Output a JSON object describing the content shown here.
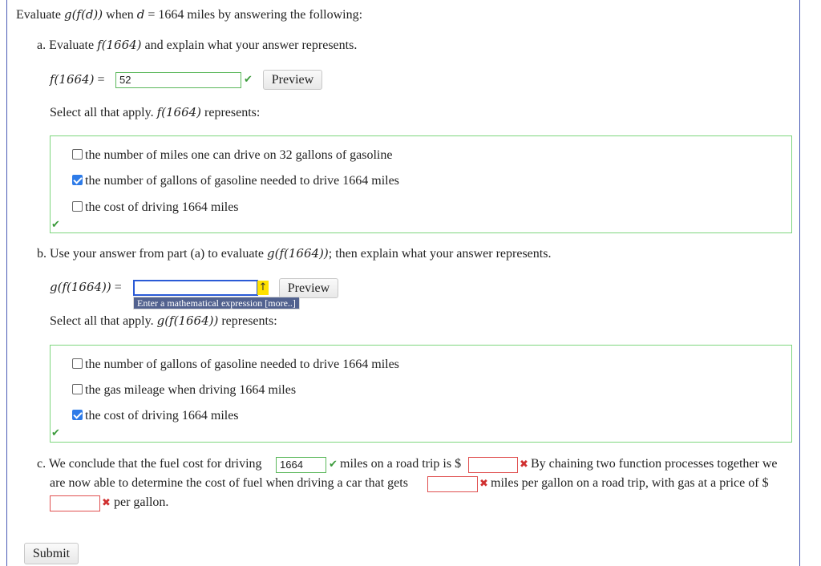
{
  "intro": {
    "pre": "Evaluate ",
    "expr": "g(f(d))",
    "mid": " when ",
    "var": "d",
    "eq": " = 1664 miles by answering the following:"
  },
  "part_a": {
    "heading": "a. Evaluate ",
    "heading_expr": "f(1664)",
    "heading_post": " and explain what your answer represents.",
    "lhs": "f(1664)",
    "equals": "=",
    "answer": "52",
    "preview_label": "Preview",
    "select_pre": "Select all that apply. ",
    "select_expr": "f(1664)",
    "select_post": " represents:",
    "options": [
      {
        "label": "the number of miles one can drive on 32 gallons of gasoline",
        "checked": false
      },
      {
        "label": "the number of gallons of gasoline needed to drive 1664 miles",
        "checked": true
      },
      {
        "label": "the cost of driving 1664 miles",
        "checked": false
      }
    ]
  },
  "part_b": {
    "heading": "b. Use your answer from part (a) to evaluate ",
    "heading_expr": "g(f(1664))",
    "heading_post": "; then explain what your answer represents.",
    "lhs": "g(f(1664))",
    "equals": "=",
    "answer": "",
    "hint": "Enter a mathematical expression [more..]",
    "preview_label": "Preview",
    "select_pre": "Select all that apply. ",
    "select_expr": "g(f(1664))",
    "select_post": " represents:",
    "options": [
      {
        "label": "the number of gallons of gasoline needed to drive 1664 miles",
        "checked": false
      },
      {
        "label": "the gas mileage when driving 1664 miles",
        "checked": false
      },
      {
        "label": "the cost of driving 1664 miles",
        "checked": true
      }
    ]
  },
  "part_c": {
    "t1": "c. We conclude that the fuel cost for driving",
    "miles_value": "1664",
    "t2": "miles on a road trip is $",
    "cost_value": "",
    "t3": "By chaining two function processes together we",
    "t4": "are now able to determine the cost of fuel when driving a car that gets",
    "mpg_value": "",
    "t5": "miles per gallon on a road trip, with gas at a price of $",
    "price_value": "",
    "t6": "per gallon."
  },
  "submit_label": "Submit",
  "icons": {
    "correct": "check-icon",
    "incorrect": "x-icon",
    "warning": "warning-icon"
  },
  "colors": {
    "correct": "#3a9a3a",
    "incorrect": "#d03030",
    "accent": "#2e7be8",
    "box_border": "#7ed67e"
  }
}
